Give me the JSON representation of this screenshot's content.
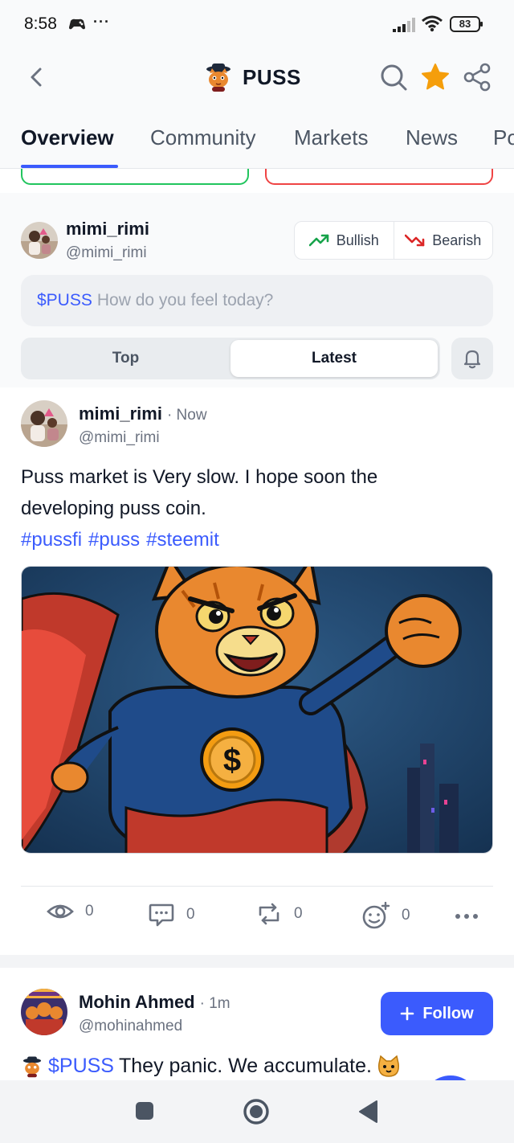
{
  "status_bar": {
    "time": "8:58",
    "more": "···",
    "battery": "83"
  },
  "header": {
    "title": "PUSS"
  },
  "tabs": [
    {
      "label": "Overview",
      "active": true
    },
    {
      "label": "Community",
      "active": false
    },
    {
      "label": "Markets",
      "active": false
    },
    {
      "label": "News",
      "active": false
    },
    {
      "label": "Po",
      "active": false
    }
  ],
  "composer": {
    "username": "mimi_rimi",
    "handle": "@mimi_rimi",
    "bullish_label": "Bullish",
    "bearish_label": "Bearish",
    "ticker": "$PUSS",
    "placeholder": "How do you feel today?",
    "sort_top": "Top",
    "sort_latest": "Latest",
    "selected_sort": "Latest"
  },
  "posts": [
    {
      "username": "mimi_rimi",
      "time": "· Now",
      "handle": "@mimi_rimi",
      "text_line1": "Puss market is Very slow. I hope soon the",
      "text_line2": "developing puss coin.",
      "hashtags": [
        "#pussfi",
        "#puss",
        "#steemit"
      ],
      "stats": {
        "views": "0",
        "comments": "0",
        "reposts": "0",
        "reactions": "0"
      }
    },
    {
      "username": "Mohin Ahmed",
      "time": "· 1m",
      "handle": "@mohinahmed",
      "follow_label": "Follow",
      "ticker": "$PUSS",
      "text": "They panic. We accumulate."
    }
  ],
  "colors": {
    "accent": "#3b5bfd",
    "bullish": "#16a34a",
    "bearish": "#dc2626",
    "star": "#f59e0b"
  }
}
